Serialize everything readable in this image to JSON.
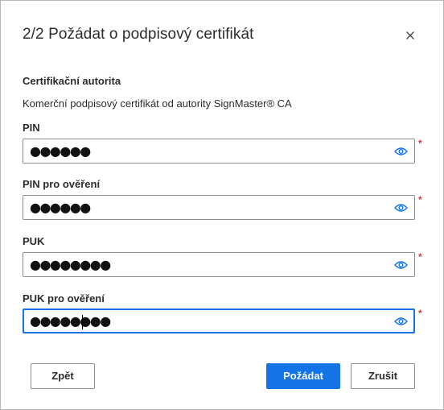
{
  "dialog": {
    "title": "2/2 Požádat o podpisový certifikát",
    "section_label": "Certifikační autorita",
    "section_text": "Komerční podpisový certifikát od autority SignMaster® CA",
    "fields": [
      {
        "label": "PIN",
        "masked_value": "●●●●●●",
        "required_mark": "*"
      },
      {
        "label": "PIN pro ověření",
        "masked_value": "●●●●●●",
        "required_mark": "*"
      },
      {
        "label": "PUK",
        "masked_value": "●●●●●●●●",
        "required_mark": "*"
      },
      {
        "label": "PUK pro ověření",
        "masked_value": "●●●●●●●●",
        "required_mark": "*"
      }
    ],
    "buttons": {
      "back": "Zpět",
      "request": "Požádat",
      "cancel": "Zrušit"
    },
    "colors": {
      "accent": "#1473e6",
      "required": "#d7373f"
    },
    "icons": {
      "close": "close-icon",
      "reveal": "eye-icon"
    }
  }
}
